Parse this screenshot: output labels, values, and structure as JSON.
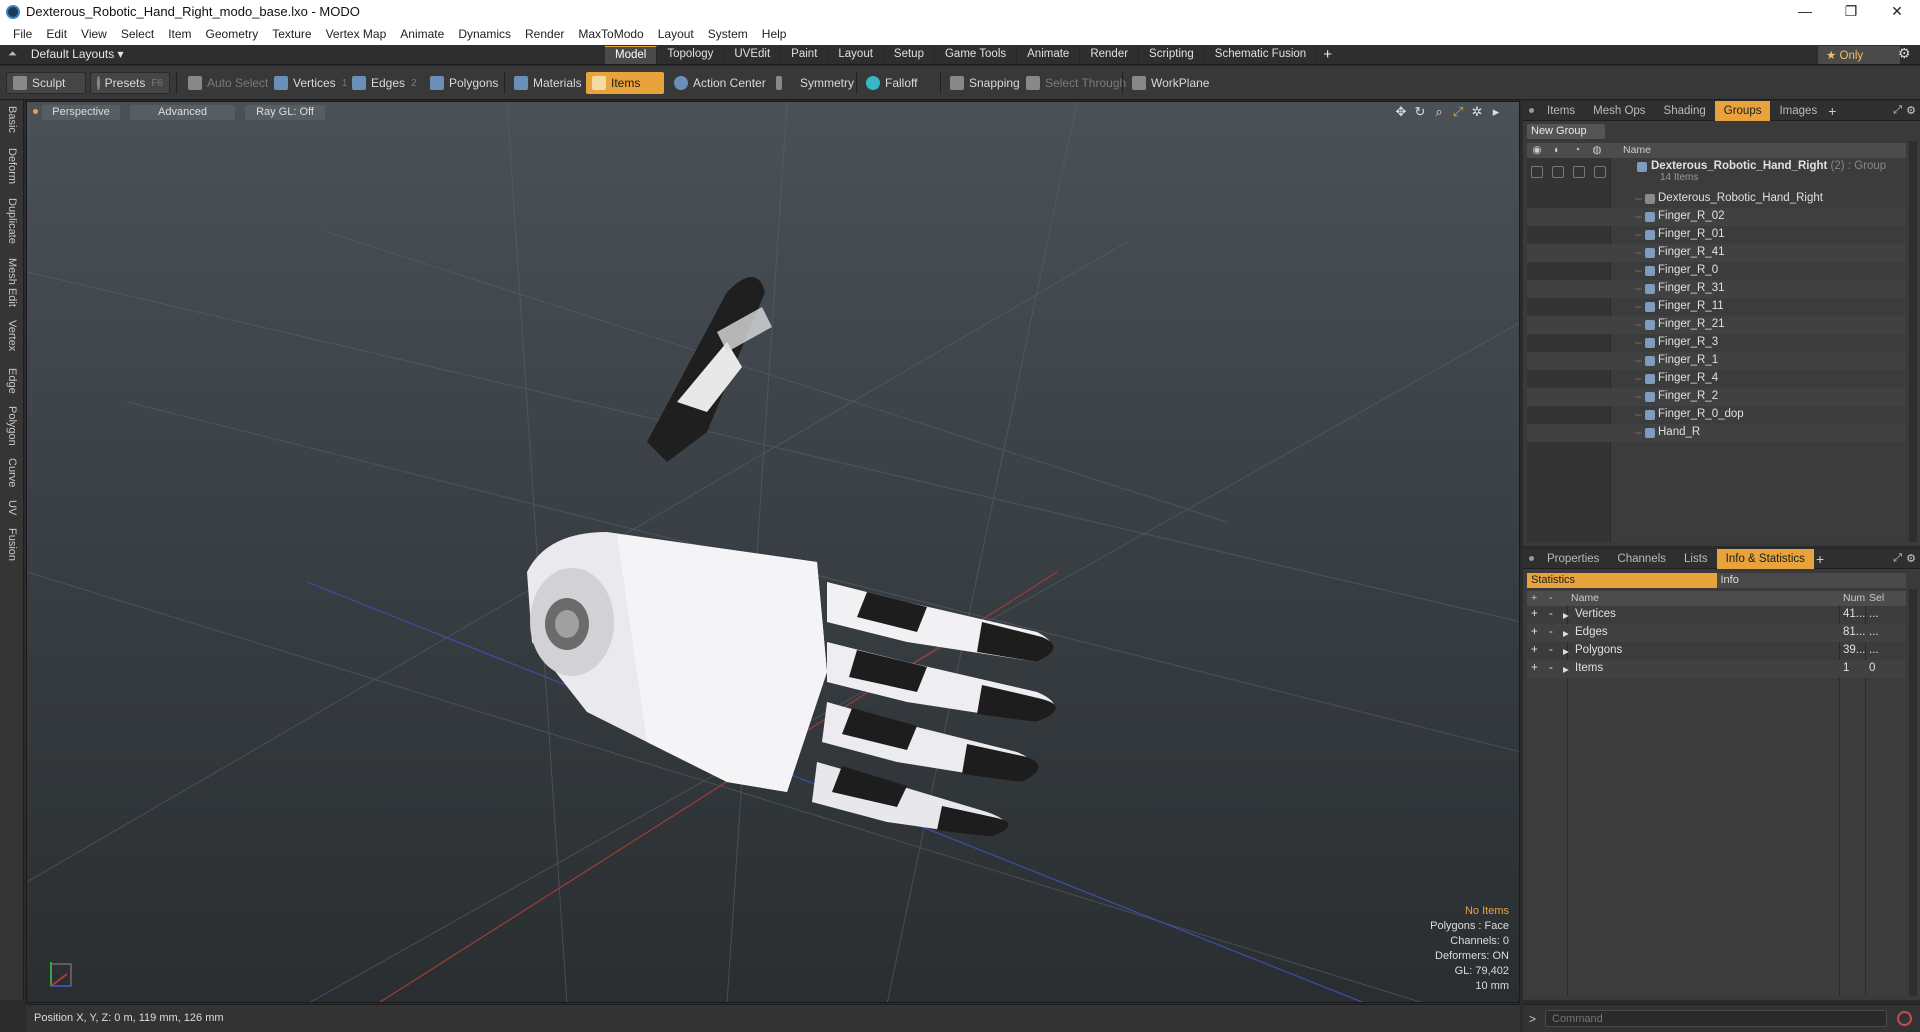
{
  "window": {
    "title": "Dexterous_Robotic_Hand_Right_modo_base.lxo - MODO",
    "minimize": "—",
    "maximize": "❐",
    "close": "✕"
  },
  "menu": [
    "File",
    "Edit",
    "View",
    "Select",
    "Item",
    "Geometry",
    "Texture",
    "Vertex Map",
    "Animate",
    "Dynamics",
    "Render",
    "MaxToModo",
    "Layout",
    "System",
    "Help"
  ],
  "layout_bar": {
    "layouts_label": "Default Layouts ▾",
    "tabs": [
      "Model",
      "Topology",
      "UVEdit",
      "Paint",
      "Layout",
      "Setup",
      "Game Tools",
      "Animate",
      "Render",
      "Scripting",
      "Schematic Fusion"
    ],
    "active_tab": "Model",
    "only_label": "★ Only"
  },
  "toolbar": {
    "sculpt": "Sculpt",
    "presets": "Presets",
    "presets_key": "F6",
    "auto_select": "Auto Select",
    "vertices": "Vertices",
    "vertices_key": "1",
    "edges": "Edges",
    "edges_key": "2",
    "polygons": "Polygons",
    "materials": "Materials",
    "items": "Items",
    "action_center": "Action Center",
    "symmetry": "Symmetry",
    "falloff": "Falloff",
    "snapping": "Snapping",
    "select_through": "Select Through",
    "workplane": "WorkPlane"
  },
  "left_tabs": [
    "Basic",
    "Deform",
    "Duplicate",
    "Mesh Edit",
    "Vertex",
    "Edge",
    "Polygon",
    "Curve",
    "UV",
    "Fusion"
  ],
  "viewport": {
    "view_mode": "Perspective",
    "shading": "Advanced",
    "raygl": "Ray GL: Off",
    "info": {
      "no_items": "No Items",
      "polygons": "Polygons : Face",
      "channels": "Channels: 0",
      "deformers": "Deformers: ON",
      "gl": "GL: 79,402",
      "scale": "10 mm"
    }
  },
  "status": {
    "position": "Position X, Y, Z:   0 m, 119 mm, 126 mm"
  },
  "groups_panel": {
    "tabs": [
      "Items",
      "Mesh Ops",
      "Shading",
      "Groups",
      "Images"
    ],
    "active_tab": "Groups",
    "new_group": "New Group",
    "name_header": "Name",
    "root": {
      "name": "Dexterous_Robotic_Hand_Right",
      "suffix": " (2) : Group",
      "sub": "14 Items"
    },
    "items": [
      "Dexterous_Robotic_Hand_Right",
      "Finger_R_02",
      "Finger_R_01",
      "Finger_R_41",
      "Finger_R_0",
      "Finger_R_31",
      "Finger_R_11",
      "Finger_R_21",
      "Finger_R_3",
      "Finger_R_1",
      "Finger_R_4",
      "Finger_R_2",
      "Finger_R_0_dop",
      "Hand_R"
    ]
  },
  "stats_panel": {
    "tabs": [
      "Properties",
      "Channels",
      "Lists",
      "Info & Statistics"
    ],
    "active_tab": "Info & Statistics",
    "sub_tabs": [
      "Statistics",
      "Info"
    ],
    "headers": {
      "name": "Name",
      "num": "Num",
      "sel": "Sel"
    },
    "rows": [
      {
        "name": "Vertices",
        "num": "41...",
        "sel": "..."
      },
      {
        "name": "Edges",
        "num": "81...",
        "sel": "..."
      },
      {
        "name": "Polygons",
        "num": "39...",
        "sel": "..."
      },
      {
        "name": "Items",
        "num": "1",
        "sel": "0"
      }
    ]
  },
  "command": {
    "placeholder": "Command"
  }
}
